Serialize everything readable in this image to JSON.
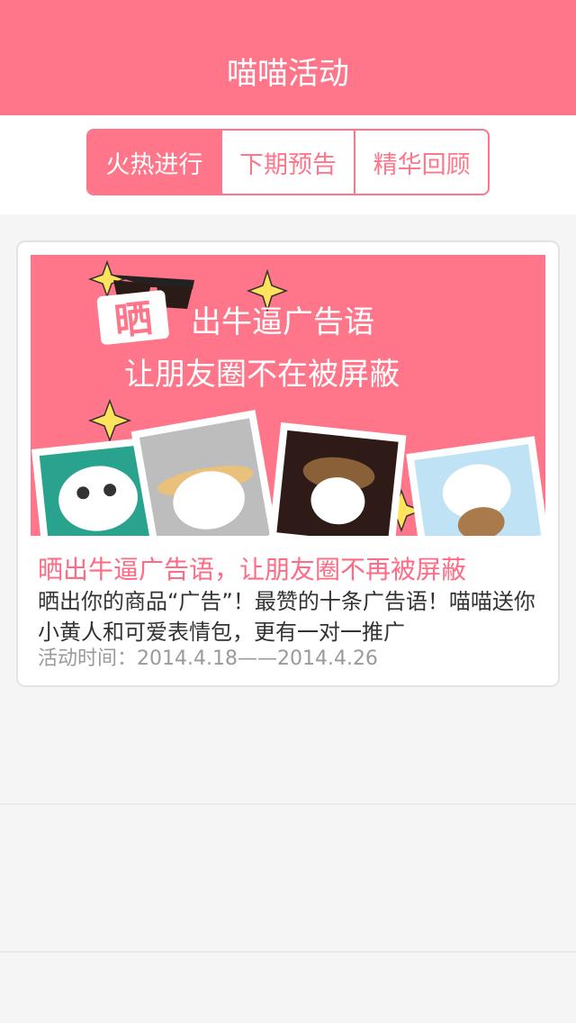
{
  "header": {
    "title": "喵喵活动"
  },
  "tabs": [
    {
      "label": "火热进行",
      "active": true
    },
    {
      "label": "下期预告",
      "active": false
    },
    {
      "label": "精华回顾",
      "active": false
    }
  ],
  "activity": {
    "banner": {
      "headline_1": "出牛逼广告语",
      "headline_badge": "晒",
      "headline_2": "让朋友圈不在被屏蔽"
    },
    "title": "晒出牛逼广告语，让朋友圈不再被屏蔽",
    "description": "晒出你的商品“广告”！最赞的十条广告语！喵喵送你小黄人和可爱表情包，更有一对一推广",
    "time": "活动时间：2014.4.18——2014.4.26"
  },
  "colors": {
    "accent": "#ff7589",
    "title_pink": "#ff6a85",
    "background": "#f5f5f5"
  }
}
